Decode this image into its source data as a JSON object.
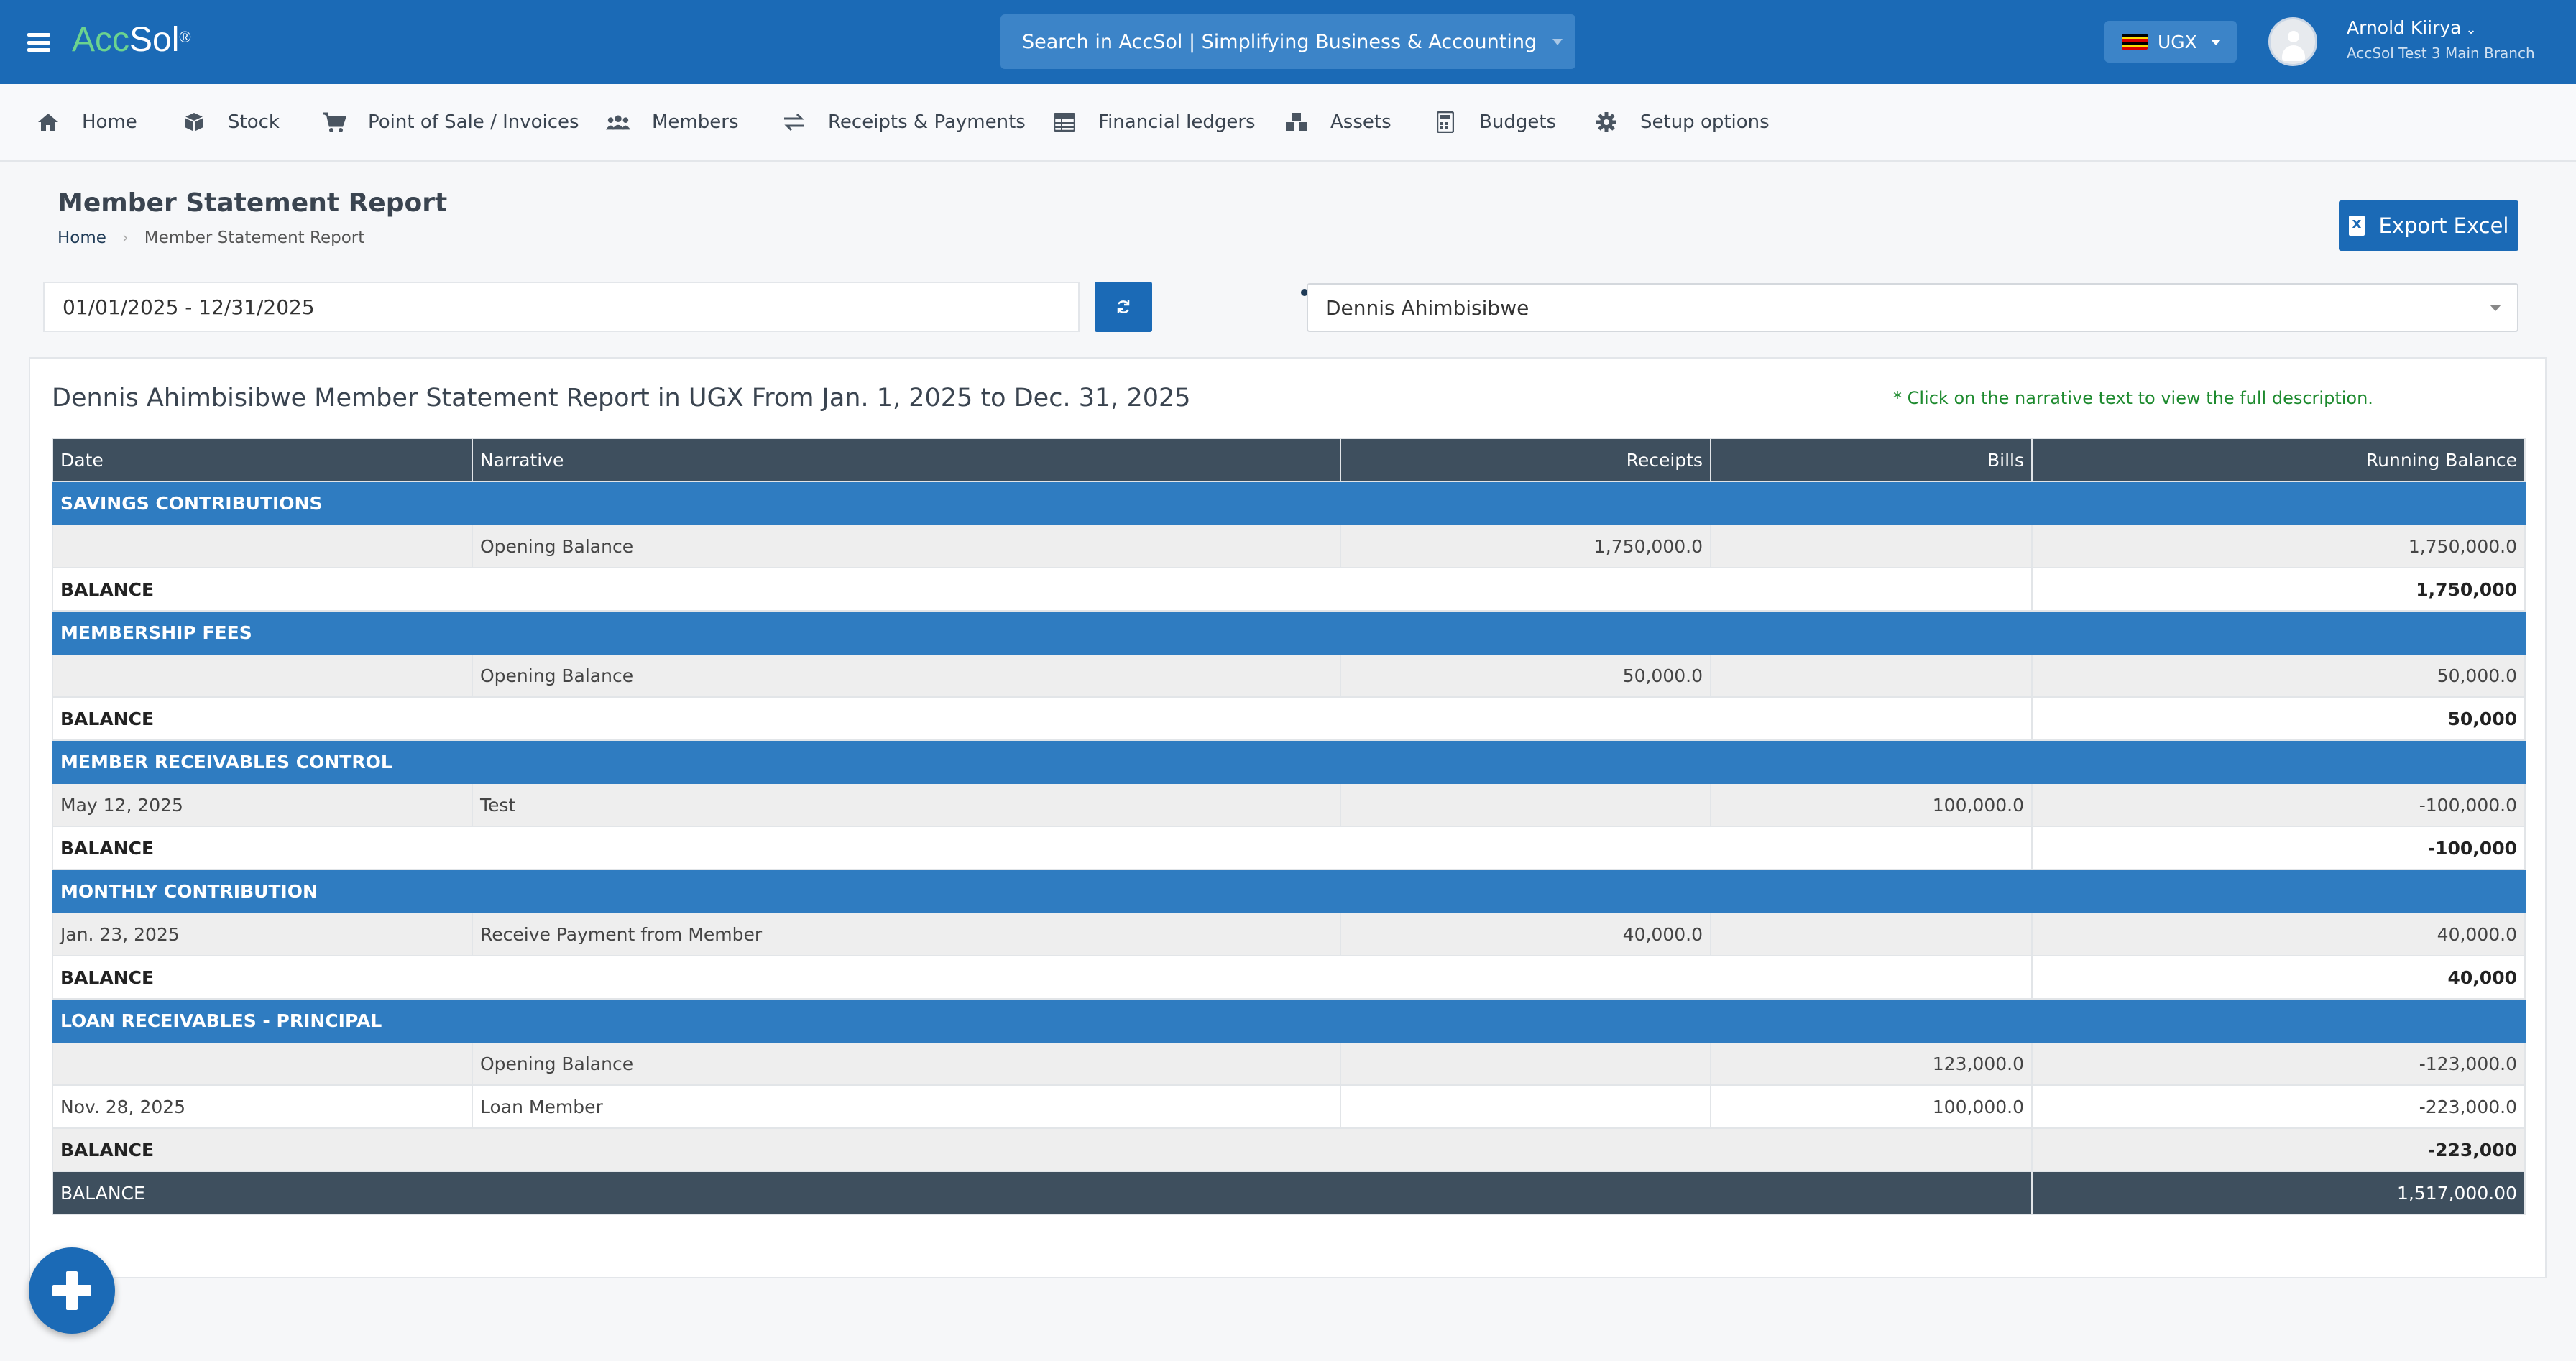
{
  "app": {
    "brand_a": "Acc",
    "brand_b": "Sol",
    "brand_reg": "®"
  },
  "header": {
    "search_placeholder": "Search in AccSol | Simplifying Business & Accounting",
    "currency": "UGX",
    "user_name": "Arnold Kiirya",
    "user_branch": "AccSol Test 3 Main Branch"
  },
  "menu": [
    {
      "label": "Home",
      "icon": "home-icon"
    },
    {
      "label": "Stock",
      "icon": "cube-icon"
    },
    {
      "label": "Point of Sale / Invoices",
      "icon": "cart-icon"
    },
    {
      "label": "Members",
      "icon": "users-icon"
    },
    {
      "label": "Receipts & Payments",
      "icon": "exchange-icon"
    },
    {
      "label": "Financial ledgers",
      "icon": "table-icon"
    },
    {
      "label": "Assets",
      "icon": "cubes-icon"
    },
    {
      "label": "Budgets",
      "icon": "calculator-icon"
    },
    {
      "label": "Setup options",
      "icon": "gear-icon"
    }
  ],
  "page": {
    "title": "Member Statement Report",
    "breadcrumb_home": "Home",
    "breadcrumb_current": "Member Statement Report",
    "export_label": "Export Excel",
    "date_range": "01/01/2025 - 12/31/2025",
    "member": "Dennis Ahimbisibwe"
  },
  "report": {
    "title": "Dennis Ahimbisibwe Member Statement Report in UGX From Jan. 1, 2025 to Dec. 31, 2025",
    "note": "* Click on the narrative text to view the full description.",
    "columns": {
      "date": "Date",
      "narrative": "Narrative",
      "receipts": "Receipts",
      "bills": "Bills",
      "running": "Running Balance"
    },
    "sections": [
      {
        "name": "SAVINGS CONTRIBUTIONS",
        "entries": [
          {
            "date": "",
            "narrative": "Opening Balance",
            "receipts": "1,750,000.0",
            "bills": "",
            "running": "1,750,000.0"
          }
        ],
        "balance_label": "BALANCE",
        "balance": "1,750,000"
      },
      {
        "name": "MEMBERSHIP FEES",
        "entries": [
          {
            "date": "",
            "narrative": "Opening Balance",
            "receipts": "50,000.0",
            "bills": "",
            "running": "50,000.0"
          }
        ],
        "balance_label": "BALANCE",
        "balance": "50,000"
      },
      {
        "name": "MEMBER RECEIVABLES CONTROL",
        "entries": [
          {
            "date": "May 12, 2025",
            "narrative": "Test",
            "receipts": "",
            "bills": "100,000.0",
            "running": "-100,000.0"
          }
        ],
        "balance_label": "BALANCE",
        "balance": "-100,000"
      },
      {
        "name": "MONTHLY CONTRIBUTION",
        "entries": [
          {
            "date": "Jan. 23, 2025",
            "narrative": "Receive Payment from Member",
            "receipts": "40,000.0",
            "bills": "",
            "running": "40,000.0"
          }
        ],
        "balance_label": "BALANCE",
        "balance": "40,000"
      },
      {
        "name": "LOAN RECEIVABLES - PRINCIPAL",
        "entries": [
          {
            "date": "",
            "narrative": "Opening Balance",
            "receipts": "",
            "bills": "123,000.0",
            "running": "-123,000.0"
          },
          {
            "date": "Nov. 28, 2025",
            "narrative": "Loan Member",
            "receipts": "",
            "bills": "100,000.0",
            "running": "-223,000.0"
          }
        ],
        "balance_label": "BALANCE",
        "balance": "-223,000"
      }
    ],
    "total_label": "BALANCE",
    "total": "1,517,000.00"
  }
}
